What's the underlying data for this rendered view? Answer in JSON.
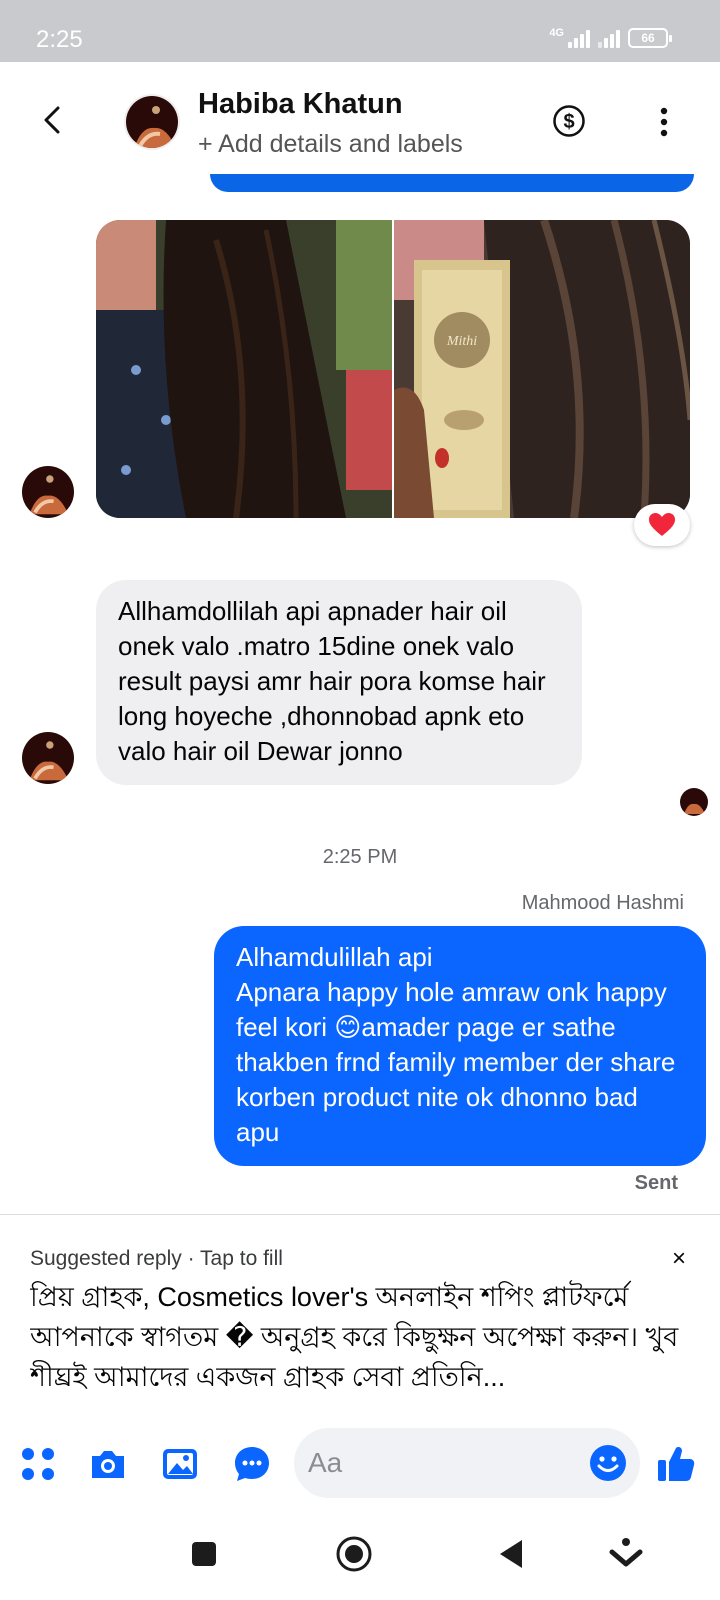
{
  "status_bar": {
    "time": "2:25",
    "network": "4G",
    "battery": "66"
  },
  "header": {
    "contact_name": "Habiba Khatun",
    "subtitle": "+ Add details and labels",
    "icons": [
      "back-arrow-icon",
      "dollar-circle-icon",
      "more-vertical-icon"
    ]
  },
  "messages": [
    {
      "type": "photos",
      "direction": "incoming",
      "reaction": "heart"
    },
    {
      "type": "text",
      "direction": "incoming",
      "text": "Allhamdollilah api apnader hair oil onek valo .matro 15dine onek valo result paysi amr hair  pora komse hair long hoyeche ,dhonnobad apnk eto valo hair oil Dewar jonno"
    },
    {
      "type": "timestamp",
      "text": "2:25 PM"
    },
    {
      "type": "text",
      "direction": "outgoing",
      "sender": "Mahmood Hashmi",
      "text": "Alhamdulillah  api\nApnara happy hole amraw onk happy feel kori  😊amader page er sathe thakben frnd family member der share korben product nite ok dhonno bad apu",
      "status": "Sent"
    }
  ],
  "suggested_reply": {
    "label": "Suggested reply · Tap to fill",
    "close": "×",
    "text": "প্রিয় গ্রাহক, Cosmetics lover's অনলাইন শপিং প্লাটফর্মে আপনাকে স্বাগতম � অনুগ্রহ করে কিছুক্ষন অপেক্ষা করুন। খুব শীঘ্রই আমাদের একজন গ্রাহক সেবা প্রতিনি..."
  },
  "composer": {
    "placeholder": "Aa",
    "icons": [
      "apps-grid-icon",
      "camera-icon",
      "gallery-icon",
      "chat-bubble-icon",
      "emoji-icon",
      "thumbs-up-icon"
    ]
  },
  "colors": {
    "accent": "#0a66ff",
    "incoming_bubble": "#efeff1",
    "status_bar": "#c9cacd"
  }
}
